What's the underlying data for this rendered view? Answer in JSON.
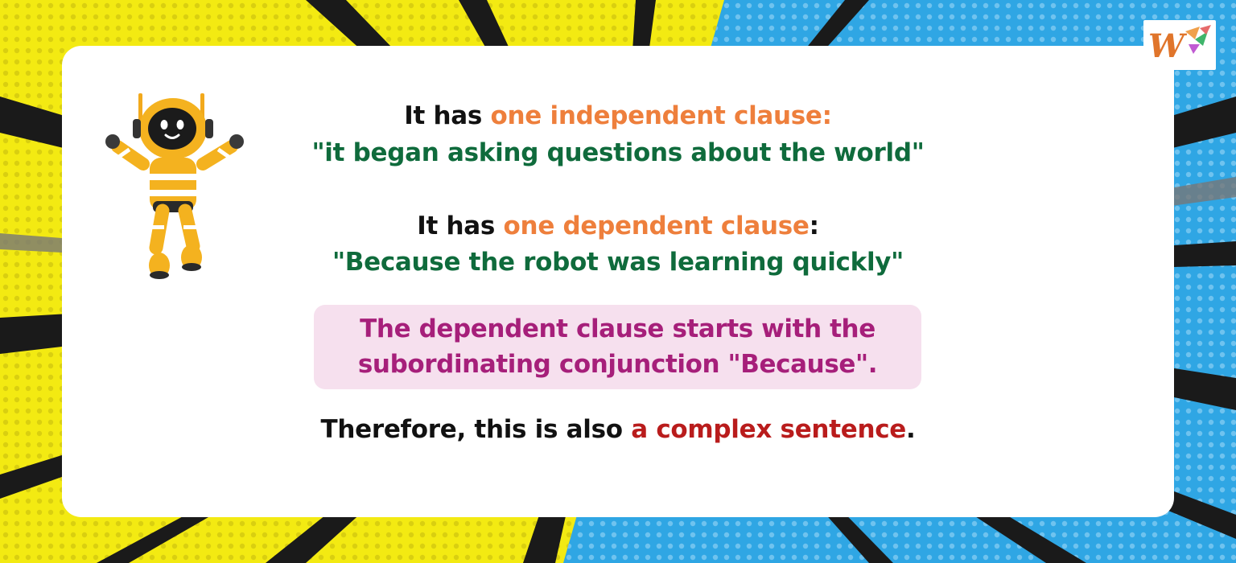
{
  "colors": {
    "yellow": "#f3ea12",
    "blue": "#2fa6e4",
    "orange": "#ee7f3c",
    "green": "#0f6b3c",
    "magenta": "#a61f7a",
    "red": "#b91c1c",
    "note_bg": "#f6e0ee"
  },
  "logo": {
    "icon": "w-brand-logo",
    "letter": "W"
  },
  "robot": {
    "icon": "robot-illustration"
  },
  "independent": {
    "lead": "It has ",
    "label": "one independent clause:",
    "quote": "\"it began asking questions about the world\""
  },
  "dependent": {
    "lead": "It has ",
    "label": "one dependent clause",
    "colon": ":",
    "quote": "\"Because the robot was learning quickly\""
  },
  "note": {
    "line1": "The dependent clause starts with the",
    "line2": "subordinating conjunction \"Because\"."
  },
  "conclusion": {
    "lead": "Therefore, this is also ",
    "highlight": "a complex sentence",
    "end": "."
  }
}
